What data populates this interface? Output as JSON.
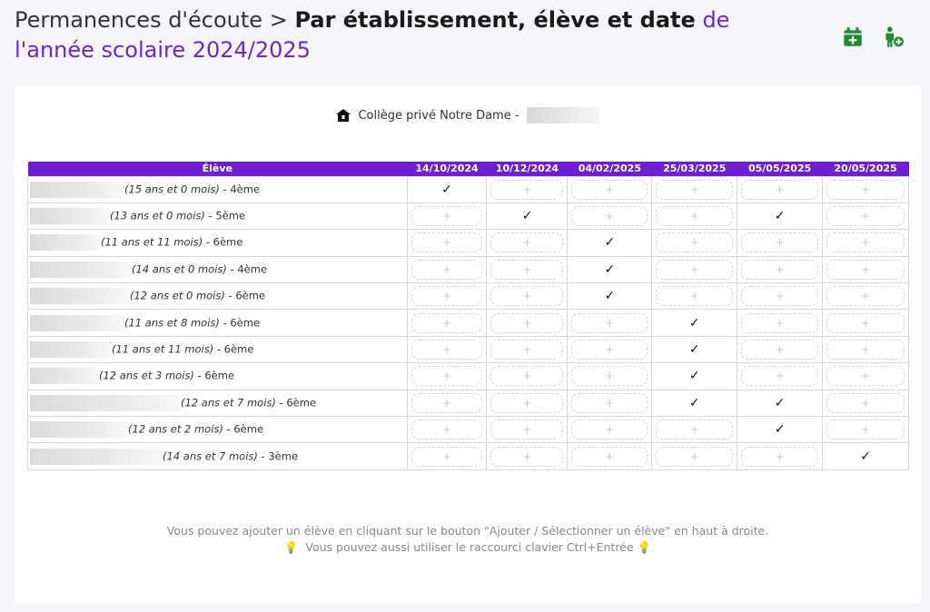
{
  "header": {
    "prefix": "Permanences d'écoute > ",
    "title": "Par établissement, élève et date",
    "suffix": " de l'année scolaire 2024/2025"
  },
  "school": {
    "name": "Collège privé Notre Dame -"
  },
  "table": {
    "student_header": "Élève",
    "dates": [
      "14/10/2024",
      "10/12/2024",
      "04/02/2025",
      "25/03/2025",
      "05/05/2025",
      "20/05/2025"
    ],
    "slot_symbol": "+",
    "check_symbol": "✓",
    "rows": [
      {
        "age": "(15 ans et 0 mois)",
        "level": " - 4ème",
        "checks": [
          1,
          0,
          0,
          0,
          0,
          0
        ]
      },
      {
        "age": "(13 ans et 0 mois)",
        "level": " - 5ème",
        "checks": [
          0,
          1,
          0,
          0,
          1,
          0
        ]
      },
      {
        "age": "(11 ans et 11 mois)",
        "level": " - 6ème",
        "checks": [
          0,
          0,
          1,
          0,
          0,
          0
        ]
      },
      {
        "age": "(14 ans et 0 mois)",
        "level": " - 4ème",
        "checks": [
          0,
          0,
          1,
          0,
          0,
          0
        ]
      },
      {
        "age": "(12 ans et 0 mois)",
        "level": " - 6ème",
        "checks": [
          0,
          0,
          1,
          0,
          0,
          0
        ]
      },
      {
        "age": "(11 ans et 8 mois)",
        "level": " - 6ème",
        "checks": [
          0,
          0,
          0,
          1,
          0,
          0
        ]
      },
      {
        "age": "(11 ans et 11 mois)",
        "level": " - 6ème",
        "checks": [
          0,
          0,
          0,
          1,
          0,
          0
        ]
      },
      {
        "age": "(12 ans et 3 mois)",
        "level": " - 6ème",
        "checks": [
          0,
          0,
          0,
          1,
          0,
          0
        ]
      },
      {
        "age": "(12 ans et 7 mois)",
        "level": " - 6ème",
        "checks": [
          0,
          0,
          0,
          1,
          1,
          0
        ]
      },
      {
        "age": "(12 ans et 2 mois)",
        "level": " - 6ème",
        "checks": [
          0,
          0,
          0,
          0,
          1,
          0
        ]
      },
      {
        "age": "(14 ans et 7 mois)",
        "level": " - 3ème",
        "checks": [
          0,
          0,
          0,
          0,
          0,
          1
        ]
      }
    ]
  },
  "footer": {
    "line1": "Vous pouvez ajouter un élève en cliquant sur le bouton \"Ajouter / Sélectionner un élève\" en haut à droite.",
    "line2": "Vous pouvez aussi utiliser le raccourci clavier Ctrl+Entrée",
    "bulb": "💡"
  },
  "icons": {
    "calendar": "calendar-add-icon",
    "user_add": "user-add-icon",
    "school": "school-icon"
  },
  "colors": {
    "accent": "#6f1fd0",
    "title_purple": "#6f26c9",
    "icon_green": "#1f8a2f"
  }
}
